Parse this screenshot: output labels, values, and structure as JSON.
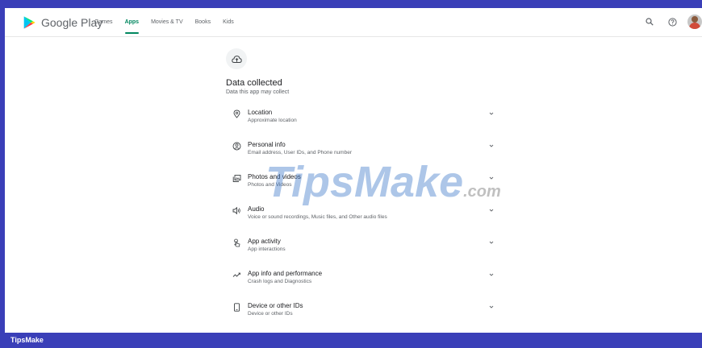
{
  "header": {
    "brand_name": "Google Play",
    "nav": [
      {
        "label": "Games"
      },
      {
        "label": "Apps"
      },
      {
        "label": "Movies & TV"
      },
      {
        "label": "Books"
      },
      {
        "label": "Kids"
      }
    ],
    "active_nav": "Apps",
    "icons": [
      "search-icon",
      "help-icon",
      "account-avatar"
    ]
  },
  "section": {
    "icon": "cloud-upload-icon",
    "title": "Data collected",
    "subtitle": "Data this app may collect"
  },
  "items": [
    {
      "icon": "location-pin-icon",
      "title": "Location",
      "desc": "Approximate location"
    },
    {
      "icon": "person-circle-icon",
      "title": "Personal info",
      "desc": "Email address, User IDs, and Phone number"
    },
    {
      "icon": "photo-icon",
      "title": "Photos and videos",
      "desc": "Photos and Videos"
    },
    {
      "icon": "volume-icon",
      "title": "Audio",
      "desc": "Voice or sound recordings, Music files, and Other audio files"
    },
    {
      "icon": "touch-app-icon",
      "title": "App activity",
      "desc": "App interactions"
    },
    {
      "icon": "performance-icon",
      "title": "App info and performance",
      "desc": "Crash logs and Diagnostics"
    },
    {
      "icon": "device-icon",
      "title": "Device or other IDs",
      "desc": "Device or other IDs"
    }
  ],
  "watermark": {
    "main": "TipsMake",
    "suffix": ".com"
  },
  "footer": {
    "label": "TipsMake"
  },
  "colors": {
    "accent": "#01875f",
    "frame": "#3a3fb8",
    "text": "#202124",
    "muted": "#5f6368"
  }
}
